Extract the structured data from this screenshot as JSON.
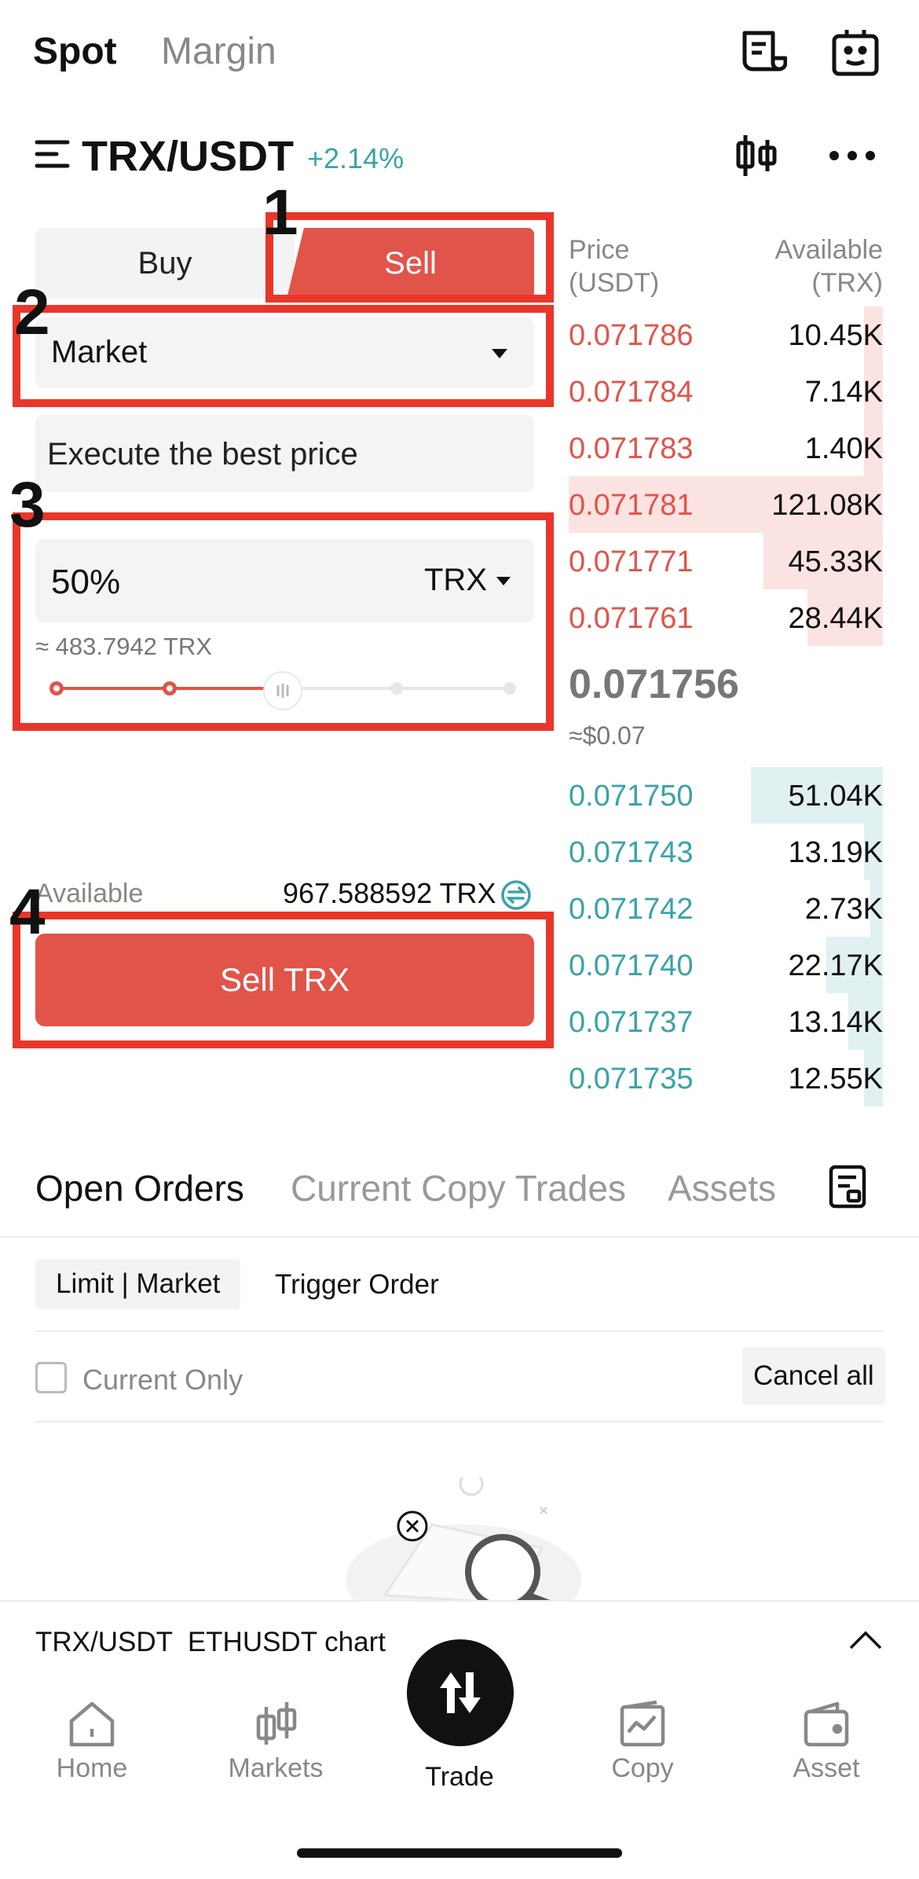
{
  "top_tabs": {
    "spot": "Spot",
    "margin": "Margin"
  },
  "pair": {
    "name": "TRX/USDT",
    "change": "+2.14%"
  },
  "order_form": {
    "buy_label": "Buy",
    "sell_label": "Sell",
    "order_type": "Market",
    "price_placeholder": "Execute the best price",
    "amount_value": "50%",
    "amount_unit": "TRX",
    "approx_amount": "≈ 483.7942 TRX",
    "slider_percent": 50,
    "available_label": "Available",
    "available_value": "967.588592 TRX",
    "submit_label": "Sell TRX"
  },
  "annotations": {
    "step1": "1",
    "step2": "2",
    "step3": "3",
    "step4": "4"
  },
  "order_book": {
    "price_header": "Price\n(USDT)",
    "qty_header": "Available\n(TRX)",
    "asks": [
      {
        "price": "0.071786",
        "qty": "10.45K",
        "depth": 0.06
      },
      {
        "price": "0.071784",
        "qty": "7.14K",
        "depth": 0.06
      },
      {
        "price": "0.071783",
        "qty": "1.40K",
        "depth": 0.06
      },
      {
        "price": "0.071781",
        "qty": "121.08K",
        "depth": 1.0
      },
      {
        "price": "0.071771",
        "qty": "45.33K",
        "depth": 0.38
      },
      {
        "price": "0.071761",
        "qty": "28.44K",
        "depth": 0.24
      }
    ],
    "last_price": "0.071756",
    "last_price_usd": "≈$0.07",
    "bids": [
      {
        "price": "0.071750",
        "qty": "51.04K",
        "depth": 0.42
      },
      {
        "price": "0.071743",
        "qty": "13.19K",
        "depth": 0.06
      },
      {
        "price": "0.071742",
        "qty": "2.73K",
        "depth": 0.04
      },
      {
        "price": "0.071740",
        "qty": "22.17K",
        "depth": 0.18
      },
      {
        "price": "0.071737",
        "qty": "13.14K",
        "depth": 0.11
      },
      {
        "price": "0.071735",
        "qty": "12.55K",
        "depth": 0.06
      }
    ]
  },
  "orders_section": {
    "tabs": [
      "Open Orders",
      "Current Copy Trades",
      "Assets"
    ],
    "sub_tabs": [
      "Limit | Market",
      "Trigger Order"
    ],
    "current_only": "Current Only",
    "cancel_all": "Cancel all"
  },
  "chart_bar": {
    "label": "TRX/USDT  ETHUSDT chart"
  },
  "bottom_nav": {
    "home": "Home",
    "markets": "Markets",
    "trade": "Trade",
    "copy": "Copy",
    "asset": "Asset"
  },
  "colors": {
    "sell": "#e1544a",
    "buy": "#3aa3a8",
    "highlight": "#e8372a"
  },
  "icons": [
    "menu-icon",
    "orders-icon",
    "bot-icon",
    "candlestick-icon",
    "more-icon",
    "dropdown-icon",
    "swap-icon",
    "history-icon",
    "chevron-up-icon",
    "home-icon",
    "markets-icon",
    "trade-icon",
    "copy-icon",
    "wallet-icon"
  ]
}
